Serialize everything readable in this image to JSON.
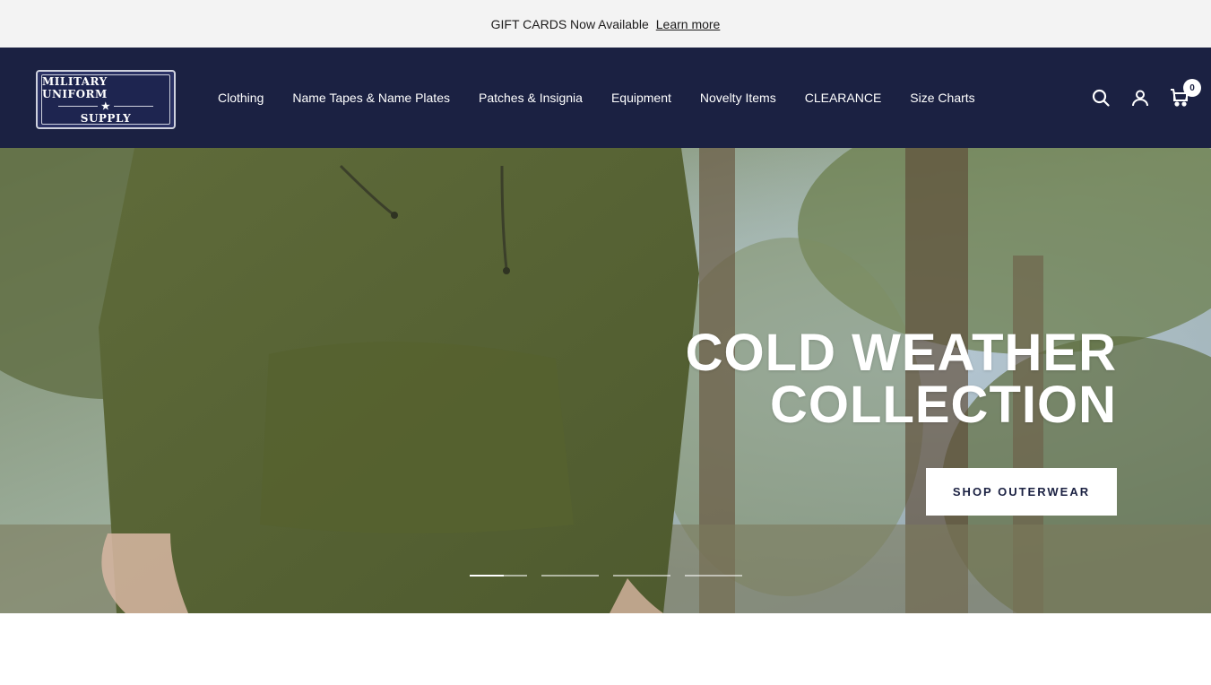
{
  "announcement": {
    "text": "GIFT CARDS Now Available",
    "link": "Learn more"
  },
  "header": {
    "logo": {
      "line1": "MILITARY UNIFORM",
      "line2": "SUPPLY"
    },
    "nav": [
      {
        "label": "Clothing"
      },
      {
        "label": "Name Tapes & Name Plates"
      },
      {
        "label": "Patches & Insignia"
      },
      {
        "label": "Equipment"
      },
      {
        "label": "Novelty Items"
      },
      {
        "label": "CLEARANCE"
      },
      {
        "label": "Size Charts"
      }
    ],
    "icons": {
      "search": "search-icon",
      "account": "user-icon",
      "cart": "cart-icon"
    },
    "cart_count": "0"
  },
  "hero": {
    "title_line1": "COLD WEATHER",
    "title_line2": "COLLECTION",
    "cta": "SHOP OUTERWEAR",
    "slides": 4,
    "active_slide": 1
  },
  "colors": {
    "header_bg": "#1b2142",
    "announcement_bg": "#f3f3f3",
    "cta_text": "#1b2142"
  }
}
